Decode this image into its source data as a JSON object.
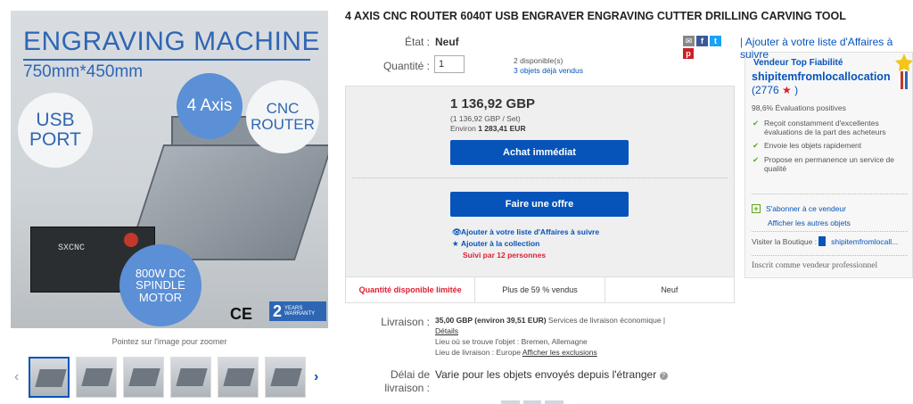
{
  "product": {
    "title": "4 AXIS CNC ROUTER 6040T USB ENGRAVER ENGRAVING CUTTER DRILLING CARVING TOOL"
  },
  "image": {
    "heading": "ENGRAVING MACHINE",
    "dimensions": "750mm*450mm",
    "bubble_usb_1": "USB",
    "bubble_usb_2": "PORT",
    "bubble_axis": "4 Axis",
    "bubble_cnc_1": "CNC",
    "bubble_cnc_2": "ROUTER",
    "bubble_spindle_1": "800W DC",
    "bubble_spindle_2": "SPINDLE",
    "bubble_spindle_3": "MOTOR",
    "control_brand": "SXCNC",
    "ce": "CE",
    "warranty_num": "2",
    "warranty_years": "YEARS",
    "warranty_word": "WARRANTY",
    "zoom_hint": "Pointez sur l'image pour zoomer",
    "thumbnail_count": 6,
    "accent_color": "#2f66b4"
  },
  "details": {
    "etat_label": "État :",
    "etat_value": "Neuf",
    "quantity_label": "Quantité :",
    "quantity_value": "1",
    "available": "2 disponible(s)",
    "sold": "3 objets déjà vendus"
  },
  "share": {
    "icons": [
      "mail-icon",
      "facebook-icon",
      "twitter-icon",
      "pinterest-icon"
    ]
  },
  "price": {
    "main": "1 136,92 GBP",
    "per_set": "(1 136,92 GBP / Set)",
    "approx_prefix": "Environ ",
    "approx_value": "1 283,41 EUR"
  },
  "buttons": {
    "buy_now": "Achat immédiat",
    "make_offer": "Faire une offre",
    "color": "#0654ba"
  },
  "actions": {
    "watchlist": "Ajouter à votre liste d'Affaires à suivre",
    "collection": "Ajouter à la collection",
    "watchers": "Suivi par 12 personnes"
  },
  "stats": {
    "limited": "Quantité disponible limitée",
    "sold_pct": "Plus de 59 % vendus",
    "condition": "Neuf"
  },
  "shipping": {
    "label": "Livraison :",
    "cost": "35,00 GBP (environ 39,51 EUR)",
    "service": " Services de livraison économique | ",
    "details_link": "Détails",
    "location": "Lieu où se trouve l'objet : Bremen, Allemagne",
    "destination_prefix": "Lieu de livraison : Europe ",
    "exclusions_link": "Afficher les exclusions"
  },
  "delay": {
    "label_1": "Délai de",
    "label_2": "livraison :",
    "value": "Varie pour les objets envoyés depuis l'étranger"
  },
  "seller": {
    "watch_link_1": "Ajouter à votre liste d'Affaires à",
    "watch_link_2": "suivre",
    "separator": "|",
    "badge": "Vendeur Top Fiabilité",
    "name": "shipitemfromlocallocation",
    "score_open": "(2776 ",
    "score_close": " )",
    "feedback": "98,6% Évaluations positives",
    "benefits": [
      "Reçoit constamment d'excellentes évaluations de la part des acheteurs",
      "Envoie les objets rapidement",
      "Propose en permanence un service de qualité"
    ],
    "subscribe": "S'abonner à ce vendeur",
    "other_items": "Afficher les autres objets",
    "store_label": "Visiter la Boutique :",
    "store_name": "shipitemfromlocall...",
    "pro": "Inscrit comme vendeur professionnel"
  }
}
